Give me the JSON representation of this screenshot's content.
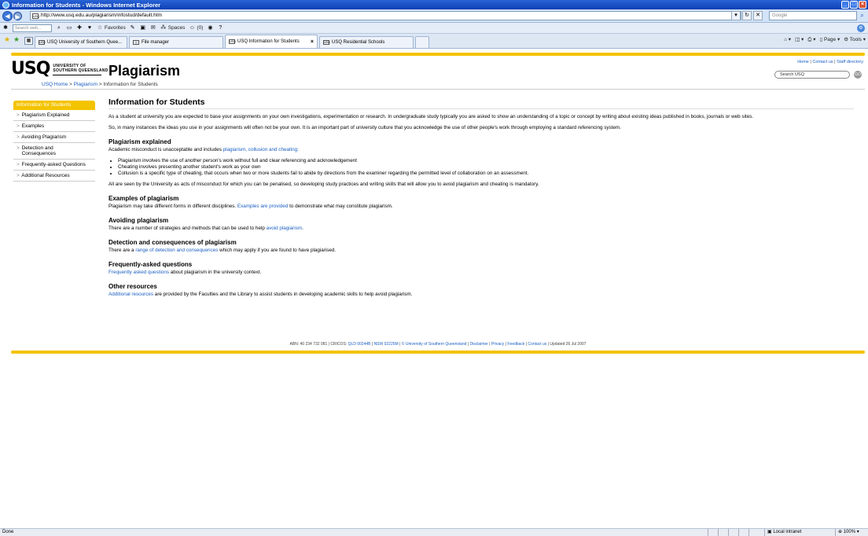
{
  "window": {
    "title": "Information for Students - Windows Internet Explorer",
    "min": "_",
    "max": "□",
    "close": "×"
  },
  "address": {
    "url": "http://www.usq.edu.au/plagiarism/infostud/default.htm",
    "search_placeholder": "Google",
    "favicon": "USQ"
  },
  "toolbar": {
    "search_placeholder": "Search web...",
    "favorites": "Favorites",
    "spaces": "Spaces",
    "mail_count": "(0)"
  },
  "tabs": [
    {
      "label": "USQ University of Southern Quee..."
    },
    {
      "label": "File manager"
    },
    {
      "label": "USQ Information for Students",
      "active": true
    },
    {
      "label": "USQ Residential Schools"
    }
  ],
  "tab_tools": {
    "page": "Page",
    "tools": "Tools"
  },
  "header": {
    "logo_mark": "USQ",
    "logo_line1": "UNIVERSITY OF",
    "logo_line2": "SOUTHERN QUEENSLAND",
    "site_title": "Plagiarism",
    "util_home": "Home",
    "util_contact": "Contact us",
    "util_staff": "Staff directory",
    "search_value": "Search USQ",
    "search_go": "GO"
  },
  "breadcrumb": {
    "home": "USQ Home",
    "section": "Plagiarism",
    "current": "Information for Students"
  },
  "sidebar": {
    "heading": "Information for Students",
    "items": [
      {
        "label": "Plagiarism Explained"
      },
      {
        "label": "Examples"
      },
      {
        "label": "Avoiding Plagiarism"
      },
      {
        "label": "Detection and Consequences"
      },
      {
        "label": "Frequently-asked Questions"
      },
      {
        "label": "Additional Resources"
      }
    ]
  },
  "main": {
    "title": "Information for Students",
    "intro1": "As a student at university you are expected to base your assignments on your own investigations, experimentation or research. In undergraduate study typically you are asked to show an understanding of a topic or concept by writing about existing ideas published in books, journals or web sites.",
    "intro2": "So, in many instances the ideas you use in your assignments will often not be your own. It is an important part of university culture that you acknowledge the use of other people's work through employing a standard referencing system.",
    "s1_heading": "Plagiarism explained",
    "s1_text": "Academic misconduct is unacceptable and includes ",
    "s1_link": "plagiarism, collusion and cheating:",
    "bullets": [
      "Plagiarism involves the use of another person's work without full and clear referencing and acknowledgement",
      "Cheating involves presenting another student's work as your own",
      "Collusion is a specific type of cheating, that occurs when two or more students fail to abide by directions from the examiner regarding the permitted level of collaboration on an assessment."
    ],
    "s1_after": "All are seen by the University as acts of misconduct for which you can be penalised, so developing study practices and writing skills that will allow you to avoid plagiarism and cheating is mandatory.",
    "s2_heading": "Examples of plagiarism",
    "s2_pre": "Plagiarism may take different forms in different disciplines. ",
    "s2_link": "Examples are provided",
    "s2_post": " to demonstrate what may constitute plagiarism.",
    "s3_heading": "Avoiding plagiarism",
    "s3_pre": "There are a number of strategies and methods that can be used to help ",
    "s3_link": "avoid plagiarism",
    "s3_post": ".",
    "s4_heading": "Detection and consequences of plagiarism",
    "s4_pre": "There are a ",
    "s4_link": "range of detection and consequences",
    "s4_post": "  which may apply if you are found to have plagiarised.",
    "s5_heading": "Frequently-asked questions",
    "s5_link": "Frequently asked questions",
    "s5_post": " about plagiarism in the university context.",
    "s6_heading": "Other resources",
    "s6_link": "Additional resources",
    "s6_post": " are provided by the Faculties and the Library to assist students in developing academic skills to help avoid plagiarism."
  },
  "footer": {
    "abn": "ABN: 40 234 732 081 | CRICOS: ",
    "qld": "QLD 00244B",
    "nsw": "NSW 02225M",
    "copyright": "© University of Southern Queensland",
    "disclaimer": "Disclaimer",
    "privacy": "Privacy",
    "feedback": "Feedback",
    "contact": "Contact us",
    "updated": " | Updated 26 Jul 2007"
  },
  "status": {
    "text": "Done",
    "zone": "Local intranet",
    "zoom": "100%"
  },
  "colors": {
    "accent_gold": "#f4c300",
    "link_blue": "#1b5fc1"
  }
}
